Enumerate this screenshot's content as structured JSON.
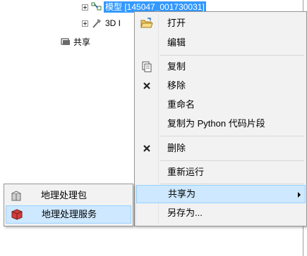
{
  "tree": {
    "items": [
      {
        "label": "模型 [145047_001730031]",
        "icon": "model-icon",
        "selected": true
      },
      {
        "label": "3D I",
        "icon": "tool-icon",
        "selected": false
      },
      {
        "label": "共享",
        "icon": "share-folder-icon",
        "selected": false
      }
    ]
  },
  "context_menu": {
    "items": [
      {
        "label": "打开",
        "icon": "open-folder-icon"
      },
      {
        "label": "编辑",
        "icon": ""
      },
      {
        "label": "复制",
        "icon": "copy-icon"
      },
      {
        "label": "移除",
        "icon": "remove-x-icon"
      },
      {
        "label": "重命名",
        "icon": ""
      },
      {
        "label": "复制为 Python 代码片段",
        "icon": ""
      },
      {
        "label": "删除",
        "icon": "delete-x-icon"
      },
      {
        "label": "重新运行",
        "icon": ""
      },
      {
        "label": "共享为",
        "icon": "",
        "has_submenu": true,
        "highlighted": true
      },
      {
        "label": "另存为...",
        "icon": ""
      }
    ]
  },
  "submenu": {
    "items": [
      {
        "label": "地理处理包",
        "icon": "geoprocessing-package-icon"
      },
      {
        "label": "地理处理服务",
        "icon": "geoprocessing-service-icon",
        "highlighted": true
      }
    ]
  },
  "colors": {
    "selection": "#3399ff",
    "hover": "#cde8ff",
    "menu_bg": "#f2f2f2"
  }
}
